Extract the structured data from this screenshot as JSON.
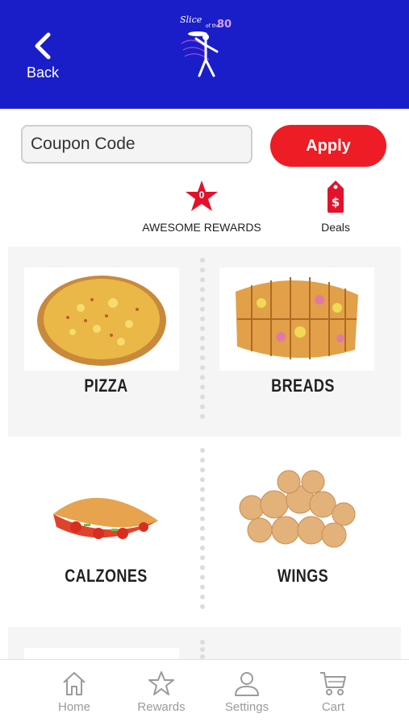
{
  "header": {
    "back_label": "Back",
    "logo_text": "Slice of the 80's"
  },
  "coupon": {
    "placeholder": "Coupon Code",
    "apply_label": "Apply"
  },
  "quick_links": {
    "rewards_label": "AWESOME REWARDS",
    "rewards_count": "0",
    "deals_label": "Deals"
  },
  "categories": [
    {
      "label": "PIZZA"
    },
    {
      "label": "BREADS"
    },
    {
      "label": "CALZONES"
    },
    {
      "label": "WINGS"
    }
  ],
  "tabs": {
    "home": "Home",
    "rewards": "Rewards",
    "settings": "Settings",
    "cart": "Cart"
  },
  "colors": {
    "header": "#1a1ec8",
    "accent": "#ee1c25",
    "tab_icon": "#9a9a9a"
  }
}
